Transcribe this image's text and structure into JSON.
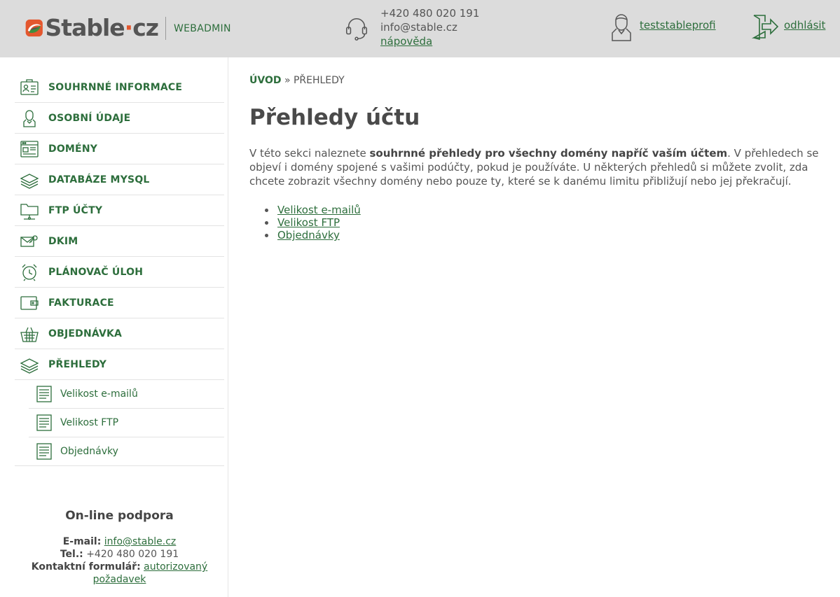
{
  "header": {
    "logo_text": "Stable",
    "logo_dot": "·",
    "logo_tld": "cz",
    "section_label": "WEBADMIN",
    "phone": "+420 480 020 191",
    "email": "info@stable.cz",
    "help_label": "nápověda",
    "username": "teststableprofi",
    "logout_label": "odhlásit"
  },
  "colors": {
    "accent": "#2d6e3c",
    "logo_orange": "#e4572e",
    "header_bg": "#dcdcdc"
  },
  "sidebar": {
    "items": [
      {
        "label": "SOUHRNNÉ INFORMACE",
        "icon": "id-card-icon"
      },
      {
        "label": "OSOBNÍ ÚDAJE",
        "icon": "person-icon"
      },
      {
        "label": "DOMÉNY",
        "icon": "browser-window-icon"
      },
      {
        "label": "DATABÁZE MYSQL",
        "icon": "database-stack-icon"
      },
      {
        "label": "FTP ÚČTY",
        "icon": "folder-network-icon"
      },
      {
        "label": "DKIM",
        "icon": "envelope-key-icon"
      },
      {
        "label": "PLÁNOVAČ ÚLOH",
        "icon": "alarm-clock-icon"
      },
      {
        "label": "FAKTURACE",
        "icon": "wallet-icon"
      },
      {
        "label": "OBJEDNÁVKA",
        "icon": "shopping-basket-icon"
      },
      {
        "label": "PŘEHLEDY",
        "icon": "layers-icon"
      }
    ],
    "subitems": [
      {
        "label": "Velikost e-mailů",
        "icon": "report-document-icon"
      },
      {
        "label": "Velikost FTP",
        "icon": "report-document-icon"
      },
      {
        "label": "Objednávky",
        "icon": "report-document-icon"
      }
    ],
    "support": {
      "title": "On-line podpora",
      "email_label": "E-mail:",
      "email_value": "info@stable.cz",
      "phone_label": "Tel.:",
      "phone_value": "+420 480 020 191",
      "form_label": "Kontaktní formulář:",
      "form_link": "autorizovaný požadavek"
    }
  },
  "main": {
    "breadcrumb_home": "ÚVOD",
    "breadcrumb_sep": "»",
    "breadcrumb_current": "PŘEHLEDY",
    "title": "Přehledy účtu",
    "intro_prefix": "V této sekci naleznete ",
    "intro_bold": "souhrnné přehledy pro všechny domény napříč vaším účtem",
    "intro_suffix": ". V přehledech se objeví i domény spojené s vašimi podúčty, pokud je používáte. U některých přehledů si můžete zvolit, zda chcete zobrazit všechny domény nebo pouze ty, které se k danému limitu přibližují nebo jej překračují.",
    "links": [
      "Velikost e-mailů",
      "Velikost FTP",
      "Objednávky"
    ]
  }
}
